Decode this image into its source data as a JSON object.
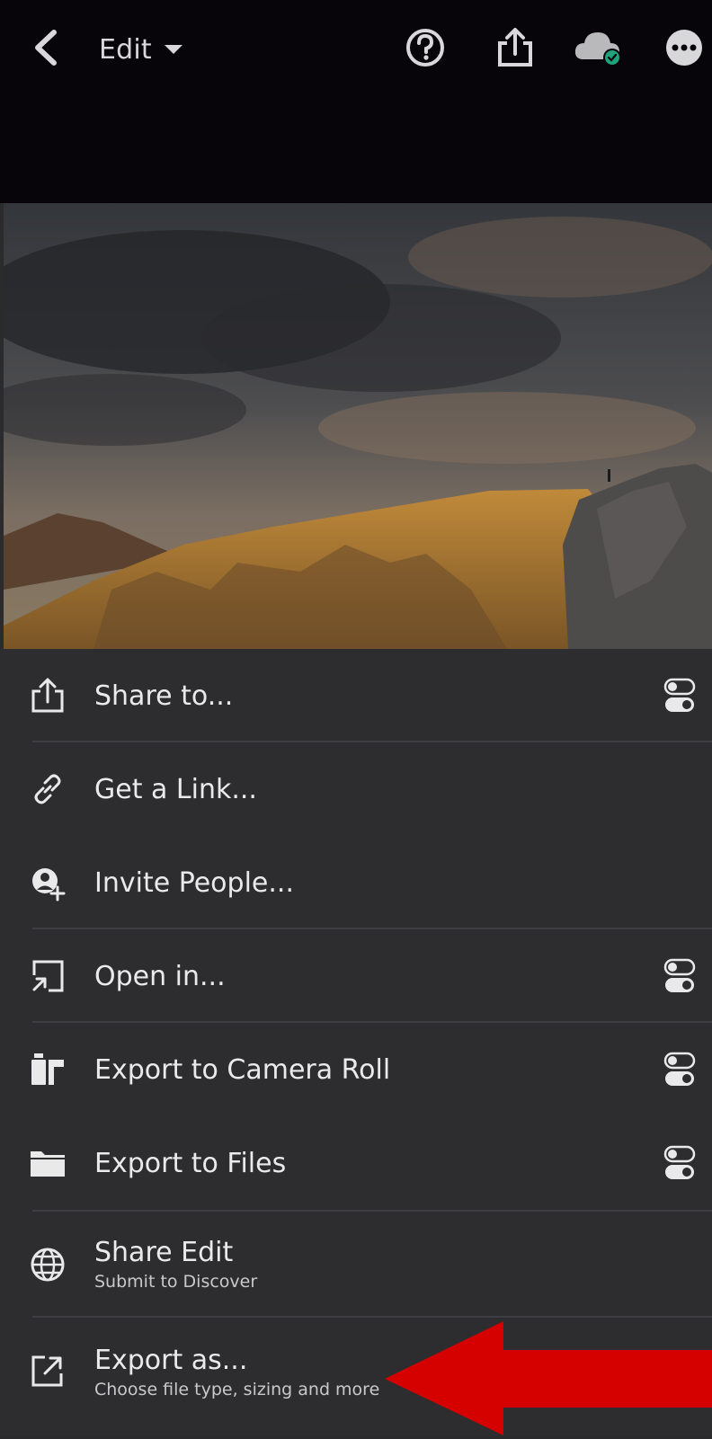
{
  "header": {
    "mode_label": "Edit",
    "icons": [
      "back-icon",
      "help-icon",
      "share-icon",
      "cloud-synced-icon",
      "more-icon"
    ]
  },
  "menu": {
    "items": [
      {
        "label": "Share to...",
        "icon": "share-icon",
        "has_toggle": true
      },
      {
        "label": "Get a Link...",
        "icon": "link-icon",
        "has_toggle": false
      },
      {
        "label": "Invite People...",
        "icon": "invite-people-icon",
        "has_toggle": false
      },
      {
        "label": "Open in...",
        "icon": "open-in-icon",
        "has_toggle": true
      },
      {
        "label": "Export to Camera Roll",
        "icon": "camera-roll-icon",
        "has_toggle": true
      },
      {
        "label": "Export to Files",
        "icon": "folder-icon",
        "has_toggle": true
      },
      {
        "label": "Share Edit",
        "sublabel": "Submit to Discover",
        "icon": "globe-icon",
        "has_toggle": false
      },
      {
        "label": "Export as...",
        "sublabel": "Choose file type, sizing and more",
        "icon": "export-icon",
        "has_toggle": false
      }
    ]
  },
  "colors": {
    "background": "#2d2c2f",
    "topbar": "#07040a",
    "text": "#eaeaeb",
    "cloud_check": "#1fa37a",
    "annotation_arrow": "#d50000"
  }
}
